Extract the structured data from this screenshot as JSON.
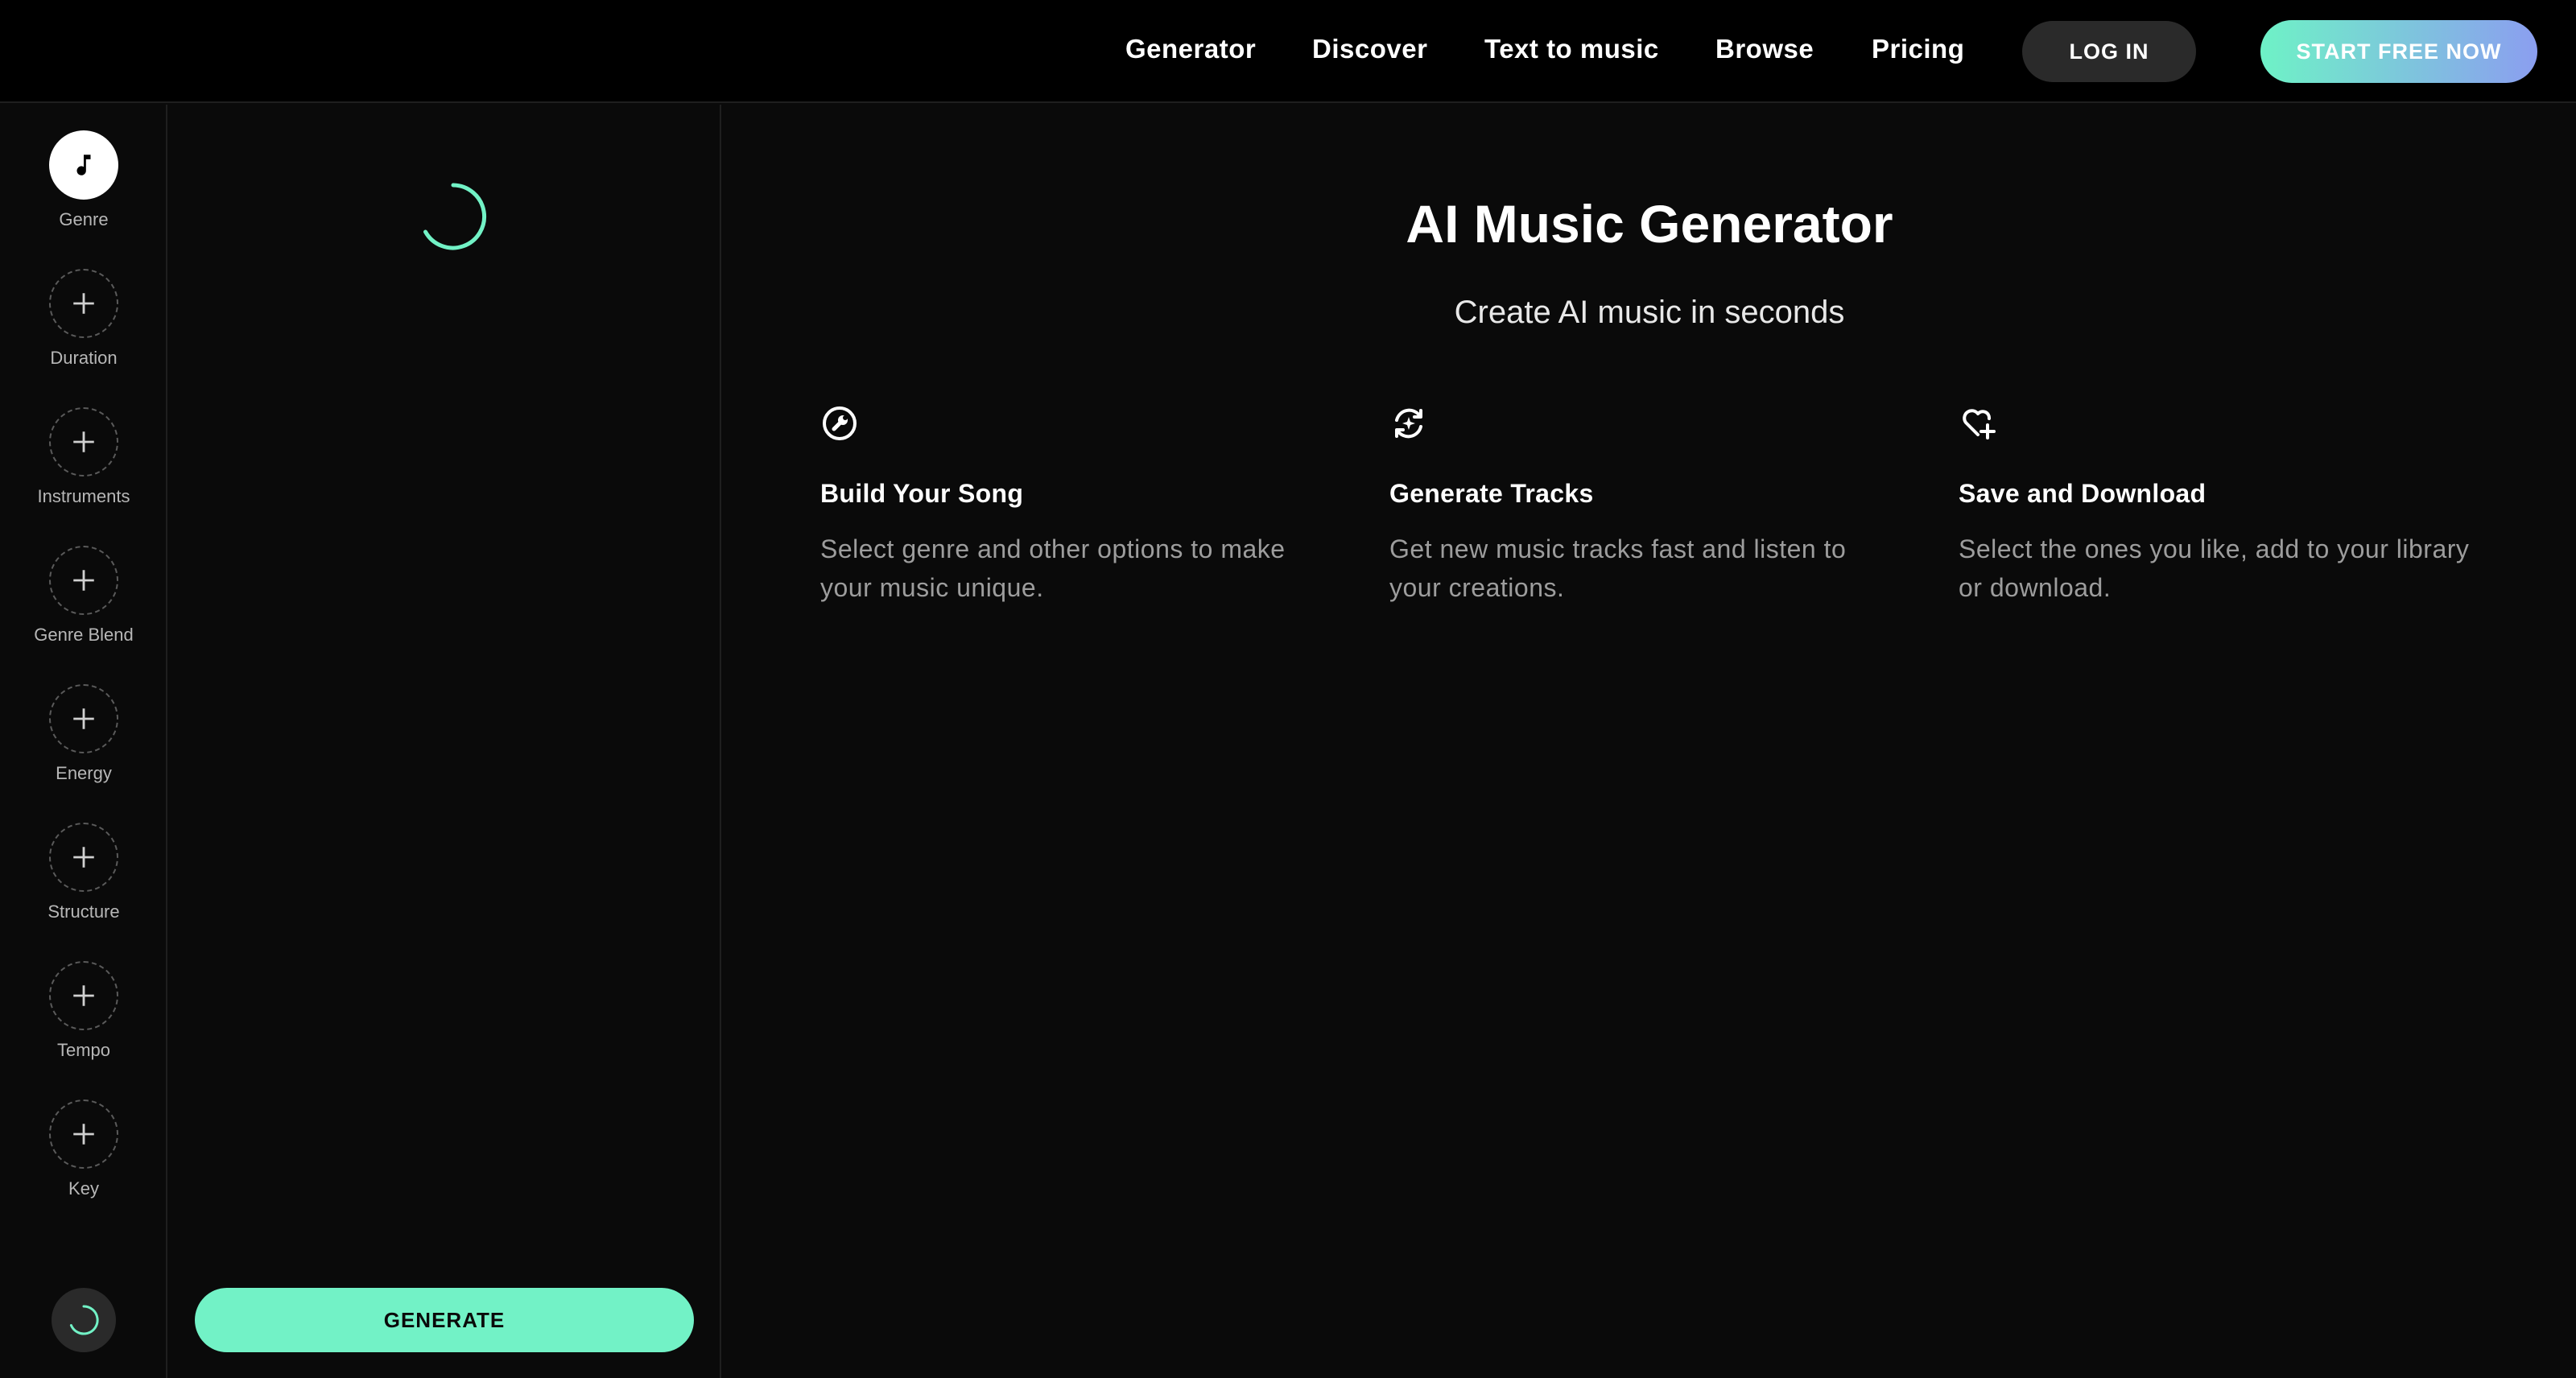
{
  "nav": {
    "links": [
      "Generator",
      "Discover",
      "Text to music",
      "Browse",
      "Pricing"
    ],
    "login_label": "LOG IN",
    "start_label": "START FREE NOW"
  },
  "sidebar": {
    "items": [
      {
        "label": "Genre",
        "icon": "music-note-icon",
        "active": true
      },
      {
        "label": "Duration",
        "icon": "plus-icon",
        "active": false
      },
      {
        "label": "Instruments",
        "icon": "plus-icon",
        "active": false
      },
      {
        "label": "Genre Blend",
        "icon": "plus-icon",
        "active": false
      },
      {
        "label": "Energy",
        "icon": "plus-icon",
        "active": false
      },
      {
        "label": "Structure",
        "icon": "plus-icon",
        "active": false
      },
      {
        "label": "Tempo",
        "icon": "plus-icon",
        "active": false
      },
      {
        "label": "Key",
        "icon": "plus-icon",
        "active": false
      }
    ]
  },
  "panel": {
    "generate_label": "GENERATE"
  },
  "main": {
    "title": "AI Music Generator",
    "subtitle": "Create AI music in seconds",
    "features": [
      {
        "icon": "wrench-icon",
        "title": "Build Your Song",
        "desc": "Select genre and other options to make your music unique."
      },
      {
        "icon": "refresh-sparkle-icon",
        "title": "Generate Tracks",
        "desc": "Get new music tracks fast and listen to your creations."
      },
      {
        "icon": "heart-plus-icon",
        "title": "Save and Download",
        "desc": "Select the ones you like, add to your library or download."
      }
    ]
  },
  "colors": {
    "accent": "#72f2c6",
    "gradient_end": "#8b9ef0",
    "background": "#0a0a0a",
    "topbar": "#000000"
  }
}
